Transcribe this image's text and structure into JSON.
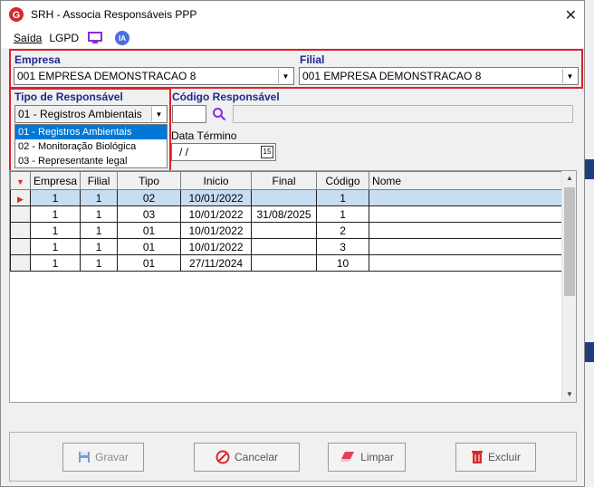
{
  "window": {
    "title": "SRH - Associa Responsáveis PPP"
  },
  "menu": {
    "saida": "Saída",
    "lgpd": "LGPD",
    "ia": "IA"
  },
  "empresa": {
    "label": "Empresa",
    "value": "001 EMPRESA DEMONSTRACAO 8"
  },
  "filial": {
    "label": "Filial",
    "value": "001 EMPRESA DEMONSTRACAO 8"
  },
  "tipo": {
    "label": "Tipo de Responsável",
    "value": "01 - Registros Ambientais",
    "options": [
      "01 - Registros Ambientais",
      "02 - Monitoração Biológica",
      "03 - Representante legal"
    ]
  },
  "codigo": {
    "label": "Código Responsável"
  },
  "data_termino": {
    "label": "Data Término",
    "value": " /  /"
  },
  "table": {
    "headers": [
      "Empresa",
      "Filial",
      "Tipo",
      "Inicio",
      "Final",
      "Código",
      "Nome"
    ],
    "rows": [
      [
        "1",
        "1",
        "02",
        "10/01/2022",
        "",
        "1",
        ""
      ],
      [
        "1",
        "1",
        "03",
        "10/01/2022",
        "31/08/2025",
        "1",
        ""
      ],
      [
        "1",
        "1",
        "01",
        "10/01/2022",
        "",
        "2",
        ""
      ],
      [
        "1",
        "1",
        "01",
        "10/01/2022",
        "",
        "3",
        ""
      ],
      [
        "1",
        "1",
        "01",
        "27/11/2024",
        "",
        "10",
        ""
      ]
    ]
  },
  "buttons": {
    "gravar": "Gravar",
    "cancelar": "Cancelar",
    "limpar": "Limpar",
    "excluir": "Excluir"
  },
  "colors": {
    "highlight": "#e0202a",
    "label_blue": "#1a2a8c",
    "selection": "#0078d7"
  }
}
